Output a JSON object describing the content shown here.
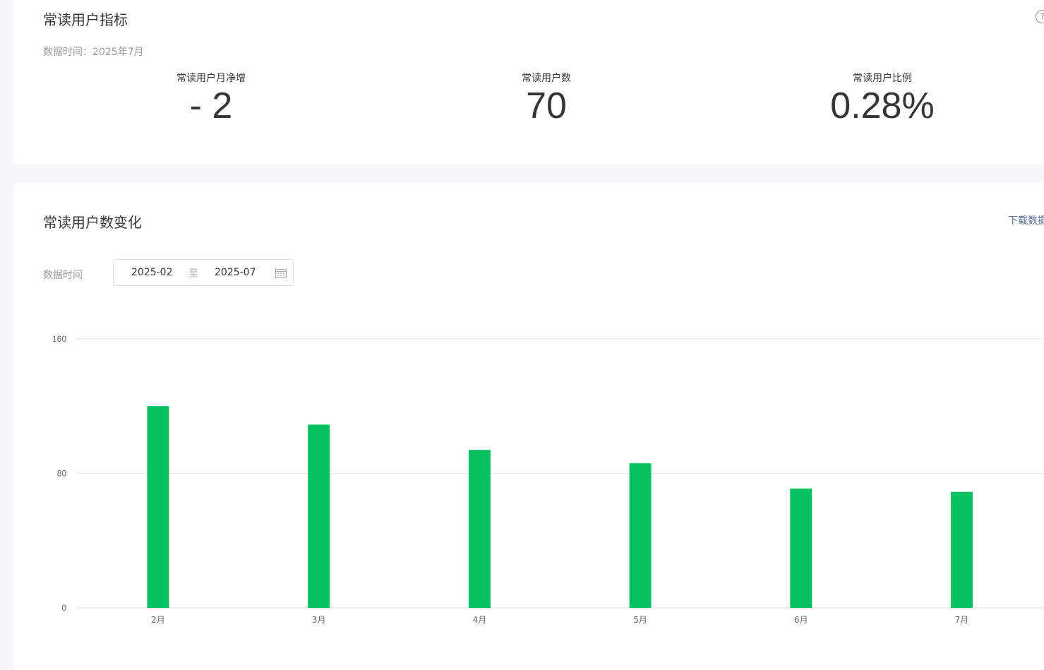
{
  "metrics_card": {
    "title": "常读用户指标",
    "help_icon": "?",
    "data_time": "数据时间：2025年7月",
    "items": [
      {
        "label": "常读用户月净增",
        "value": "- 2"
      },
      {
        "label": "常读用户数",
        "value": "70"
      },
      {
        "label": "常读用户比例",
        "value": "0.28%"
      }
    ]
  },
  "chart_card": {
    "title": "常读用户数变化",
    "download_label": "下载数据",
    "date_label": "数据时间",
    "date_start": "2025-02",
    "date_separator": "至",
    "date_end": "2025-07",
    "calendar_icon": "calendar-icon"
  },
  "colors": {
    "bar": "#07c160",
    "grid": "#e7e7e7",
    "axis": "#d9dde3",
    "tick_text": "#666666"
  },
  "chart_data": {
    "type": "bar",
    "title": "",
    "xlabel": "",
    "ylabel": "",
    "categories": [
      "2月",
      "3月",
      "4月",
      "5月",
      "6月",
      "7月"
    ],
    "values": [
      120,
      109,
      94,
      86,
      71,
      69
    ],
    "ylim": [
      0,
      160
    ],
    "yticks": [
      0,
      80,
      160
    ],
    "grid": true,
    "legend": "none"
  }
}
